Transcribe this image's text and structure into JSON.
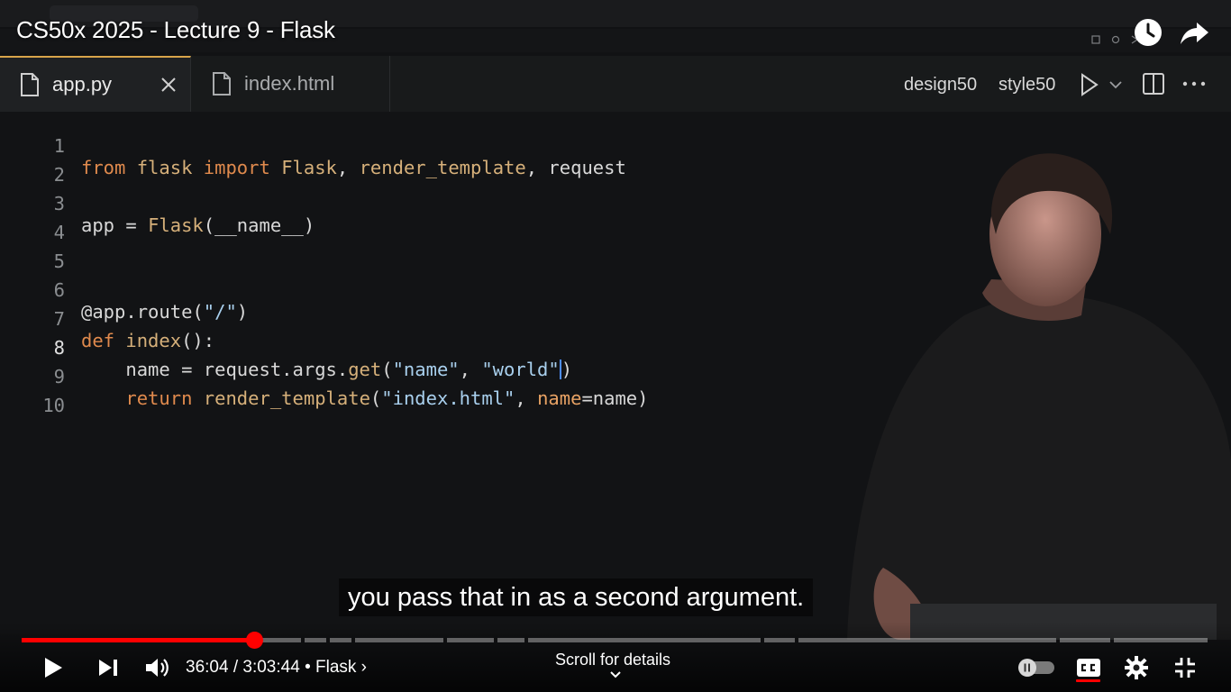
{
  "video": {
    "title": "CS50x 2025 - Lecture 9 - Flask",
    "caption": "you pass that in as a second argument."
  },
  "editor": {
    "tabs": [
      {
        "label": "app.py",
        "active": true
      },
      {
        "label": "index.html",
        "active": false
      }
    ],
    "toolbar": {
      "design_label": "design50",
      "style_label": "style50"
    },
    "code_lines": [
      {
        "num": "1"
      },
      {
        "num": "2"
      },
      {
        "num": "3"
      },
      {
        "num": "4"
      },
      {
        "num": "5"
      },
      {
        "num": "6"
      },
      {
        "num": "7"
      },
      {
        "num": "8"
      },
      {
        "num": "9"
      },
      {
        "num": "10"
      }
    ],
    "code": {
      "l1": {
        "from": "from",
        "mod": "flask",
        "import": "import",
        "cls": "Flask",
        "rest1": ", ",
        "fn": "render_template",
        "rest2": ", request"
      },
      "l3": {
        "a": "app = ",
        "cls": "Flask",
        "b": "(__name__)"
      },
      "l6": {
        "dec": "@app.route(",
        "str": "\"/\"",
        "end": ")"
      },
      "l7": {
        "kw": "def",
        "fn": "index",
        "rest": "():"
      },
      "l8": {
        "indent": "    ",
        "a": "name = request.args.",
        "fn": "get",
        "p": "(",
        "s1": "\"name\"",
        "c": ", ",
        "s2": "\"world\"",
        "end": ")"
      },
      "l9": {
        "indent": "    ",
        "kw": "return",
        "sp": " ",
        "fn": "render_template",
        "p": "(",
        "s1": "\"index.html\"",
        "c": ", ",
        "param": "name",
        "eq": "=name)"
      }
    }
  },
  "player": {
    "time": "36:04 / 3:03:44",
    "chapter": "• Flask",
    "scroll_details": "Scroll for details",
    "progress_fraction": 0.196,
    "colors": {
      "progress": "#ff0000"
    }
  }
}
